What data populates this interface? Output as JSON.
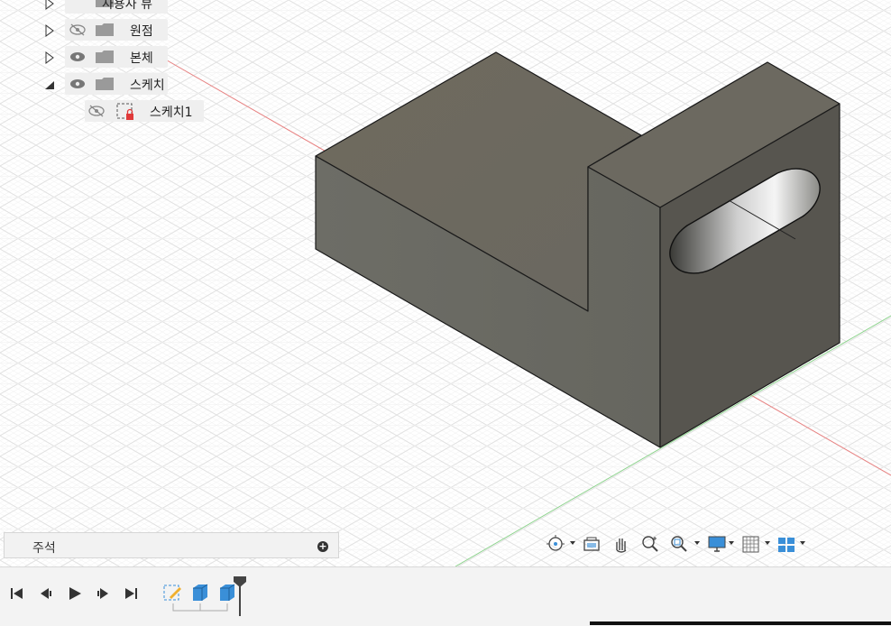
{
  "browser": {
    "items": [
      {
        "label": "사용자 뷰",
        "expanded": false,
        "visibility": "none"
      },
      {
        "label": "원점",
        "expanded": false,
        "visibility": "hidden"
      },
      {
        "label": "본체",
        "expanded": false,
        "visibility": "visible"
      },
      {
        "label": "스케치",
        "expanded": true,
        "visibility": "visible"
      }
    ],
    "children": [
      {
        "label": "스케치1",
        "visibility": "hidden"
      }
    ]
  },
  "annotation_panel": {
    "label": "주석"
  },
  "nav_toolbar": {
    "buttons": [
      "orbit-icon",
      "look-at-icon",
      "pan-icon",
      "zoom-icon",
      "fit-icon",
      "display-settings-icon",
      "grid-settings-icon",
      "viewports-icon"
    ]
  },
  "timeline": {
    "controls": [
      "go-to-start-icon",
      "step-back-icon",
      "play-icon",
      "step-forward-icon",
      "go-to-end-icon"
    ],
    "features": [
      "sketch-feature-icon",
      "extrude-feature-icon",
      "extrude-feature-icon"
    ]
  },
  "colors": {
    "model_face_top": "#6e6a60",
    "model_face_front": "#6b6b64",
    "model_face_side": "#585650",
    "axis_x": "#e06060",
    "axis_y": "#60c060",
    "grid": "#dcdcdc",
    "accent_blue": "#3a8fd8"
  }
}
